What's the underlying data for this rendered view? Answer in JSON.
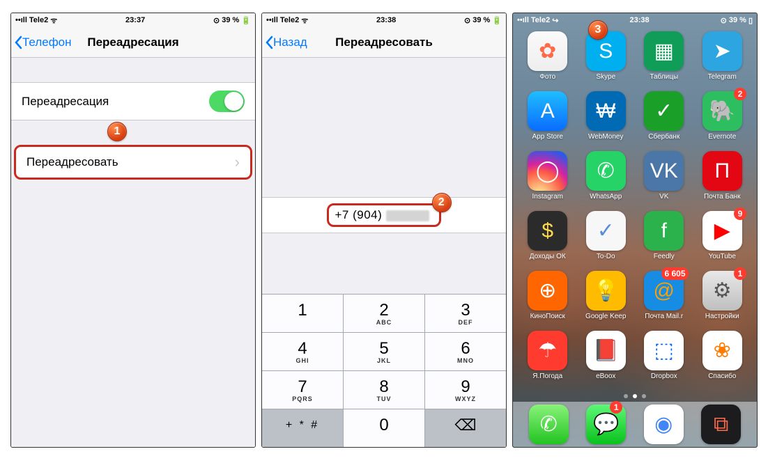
{
  "status": {
    "carrier": "Tele2",
    "batt": "39 %"
  },
  "screen1": {
    "time": "23:37",
    "back": "Телефон",
    "title": "Переадресация",
    "toggle_label": "Переадресация",
    "forward_label": "Переадресовать",
    "badge": "1"
  },
  "screen2": {
    "time": "23:38",
    "back": "Назад",
    "title": "Переадресовать",
    "phone_visible": "+7 (904) ",
    "badge": "2",
    "keys": [
      [
        "1",
        ""
      ],
      [
        "2",
        "ABC"
      ],
      [
        "3",
        "DEF"
      ],
      [
        "4",
        "GHI"
      ],
      [
        "5",
        "JKL"
      ],
      [
        "6",
        "MNO"
      ],
      [
        "7",
        "PQRS"
      ],
      [
        "8",
        "TUV"
      ],
      [
        "9",
        "WXYZ"
      ],
      [
        "+ * #",
        ""
      ],
      [
        "0",
        ""
      ],
      [
        "⌫",
        ""
      ]
    ]
  },
  "screen3": {
    "time": "23:38",
    "badge": "3",
    "apps": [
      {
        "name": "Фото",
        "bg": "linear-gradient(#fafafa,#eee)",
        "glyph": "✿",
        "fg": "#ff6b4a",
        "badge": ""
      },
      {
        "name": "Skype",
        "bg": "#00aff0",
        "glyph": "S",
        "fg": "#fff",
        "badge": ""
      },
      {
        "name": "Таблицы",
        "bg": "#0f9d58",
        "glyph": "▦",
        "fg": "#fff",
        "badge": ""
      },
      {
        "name": "Telegram",
        "bg": "#2ca5e0",
        "glyph": "➤",
        "fg": "#fff",
        "badge": ""
      },
      {
        "name": "App Store",
        "bg": "linear-gradient(#1fbdff,#0a6cff)",
        "glyph": "A",
        "fg": "#fff",
        "badge": ""
      },
      {
        "name": "WebMoney",
        "bg": "#006ab5",
        "glyph": "₩",
        "fg": "#fff",
        "badge": ""
      },
      {
        "name": "Сбербанк",
        "bg": "#1a9f29",
        "glyph": "✓",
        "fg": "#fff",
        "badge": ""
      },
      {
        "name": "Evernote",
        "bg": "#2dbe60",
        "glyph": "🐘",
        "fg": "#fff",
        "badge": "2"
      },
      {
        "name": "Instagram",
        "bg": "radial-gradient(circle at 30% 110%,#fdf497 0%,#fd5949 45%,#d6249f 60%,#285aeb 90%)",
        "glyph": "◯",
        "fg": "#fff",
        "badge": ""
      },
      {
        "name": "WhatsApp",
        "bg": "#25d366",
        "glyph": "✆",
        "fg": "#fff",
        "badge": ""
      },
      {
        "name": "VK",
        "bg": "#4a76a8",
        "glyph": "VK",
        "fg": "#fff",
        "badge": ""
      },
      {
        "name": "Почта Банк",
        "bg": "#e30613",
        "glyph": "П",
        "fg": "#fff",
        "badge": ""
      },
      {
        "name": "Доходы ОК",
        "bg": "#2b2b2b",
        "glyph": "$",
        "fg": "#ffd94a",
        "badge": ""
      },
      {
        "name": "To-Do",
        "bg": "#f7f7f7",
        "glyph": "✓",
        "fg": "#5a8dd6",
        "badge": ""
      },
      {
        "name": "Feedly",
        "bg": "#2bb24c",
        "glyph": "f",
        "fg": "#fff",
        "badge": ""
      },
      {
        "name": "YouTube",
        "bg": "#fff",
        "glyph": "▶",
        "fg": "#ff0000",
        "badge": "9"
      },
      {
        "name": "КиноПоиск",
        "bg": "#f60",
        "glyph": "⊕",
        "fg": "#fff",
        "badge": ""
      },
      {
        "name": "Google Keep",
        "bg": "#ffbb00",
        "glyph": "💡",
        "fg": "#fff",
        "badge": ""
      },
      {
        "name": "Почта Mail.r",
        "bg": "#168de2",
        "glyph": "@",
        "fg": "#ff9e00",
        "badge": "6 605"
      },
      {
        "name": "Настройки",
        "bg": "linear-gradient(#e8e8e8,#bfbfbf)",
        "glyph": "⚙",
        "fg": "#555",
        "badge": "1"
      },
      {
        "name": "Я.Погода",
        "bg": "#ff3b30",
        "glyph": "☂",
        "fg": "#fff",
        "badge": ""
      },
      {
        "name": "eBoox",
        "bg": "#fff",
        "glyph": "📕",
        "fg": "#c33",
        "badge": ""
      },
      {
        "name": "Dropbox",
        "bg": "#fff",
        "glyph": "⬚",
        "fg": "#0061ff",
        "badge": ""
      },
      {
        "name": "Спасибо",
        "bg": "#fff",
        "glyph": "❀",
        "fg": "#ff7a00",
        "badge": ""
      }
    ],
    "dock": [
      {
        "name": "phone",
        "bg": "linear-gradient(#89f37a,#22c321)",
        "glyph": "✆",
        "fg": "#fff",
        "badge": ""
      },
      {
        "name": "messages",
        "bg": "linear-gradient(#5ef777,#09c11c)",
        "glyph": "💬",
        "fg": "#fff",
        "badge": "1"
      },
      {
        "name": "chrome",
        "bg": "#fff",
        "glyph": "◉",
        "fg": "#4285f4",
        "badge": ""
      },
      {
        "name": "wallet",
        "bg": "#1c1c1e",
        "glyph": "⧉",
        "fg": "#ff6b4a",
        "badge": ""
      }
    ]
  }
}
